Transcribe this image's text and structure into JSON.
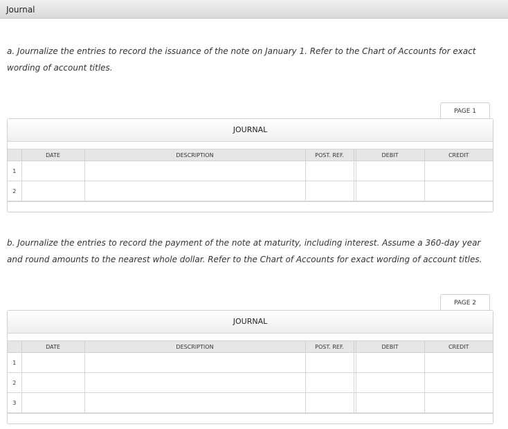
{
  "window": {
    "title": "Journal"
  },
  "part_a": {
    "instruction": "a. Journalize the entries to record the issuance of the note on January 1. Refer to the Chart of Accounts for exact wording of account titles.",
    "page_label": "PAGE 1",
    "journal_title": "JOURNAL",
    "columns": [
      "DATE",
      "DESCRIPTION",
      "POST. REF.",
      "DEBIT",
      "CREDIT"
    ],
    "rows": [
      "1",
      "2"
    ]
  },
  "part_b": {
    "instruction": "b. Journalize the entries to record the payment of the note at maturity, including interest. Assume a 360-day year and round amounts to the nearest whole dollar. Refer to the Chart of Accounts for exact wording of account titles.",
    "page_label": "PAGE 2",
    "journal_title": "JOURNAL",
    "columns": [
      "DATE",
      "DESCRIPTION",
      "POST. REF.",
      "DEBIT",
      "CREDIT"
    ],
    "rows": [
      "1",
      "2",
      "3"
    ]
  }
}
